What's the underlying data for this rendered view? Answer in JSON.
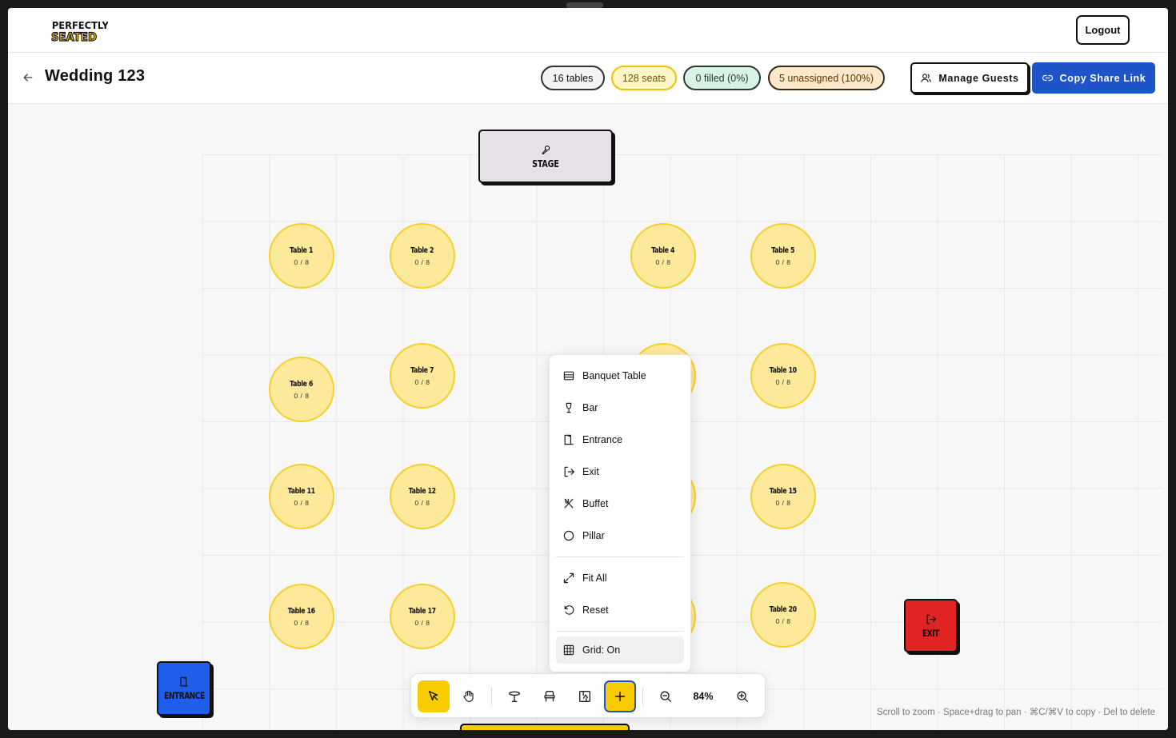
{
  "header": {
    "logo_text": "PERFECTLY SEATED",
    "logout_label": "Logout"
  },
  "subbar": {
    "title": "Wedding 123",
    "stats": {
      "tables": "16 tables",
      "seats": "128 seats",
      "filled": "0 filled (0%)",
      "unassigned": "5 unassigned (100%)"
    },
    "manage_guests_label": "Manage Guests",
    "copy_share_label": "Copy Share Link"
  },
  "canvas": {
    "stage_label": "STAGE",
    "entrance_label": "ENTRANCE",
    "exit_label": "EXIT",
    "tables": [
      {
        "name": "Table 1",
        "count": "0 / 8"
      },
      {
        "name": "Table 2",
        "count": "0 / 8"
      },
      {
        "name": "Table 4",
        "count": "0 / 8"
      },
      {
        "name": "Table 5",
        "count": "0 / 8"
      },
      {
        "name": "Table 6",
        "count": "0 / 8"
      },
      {
        "name": "Table 7",
        "count": "0 / 8"
      },
      {
        "name": "Table 10",
        "count": "0 / 8"
      },
      {
        "name": "Table 11",
        "count": "0 / 8"
      },
      {
        "name": "Table 12",
        "count": "0 / 8"
      },
      {
        "name": "Table 15",
        "count": "0 / 8"
      },
      {
        "name": "Table 16",
        "count": "0 / 8"
      },
      {
        "name": "Table 17",
        "count": "0 / 8"
      },
      {
        "name": "Table 20",
        "count": "0 / 8"
      }
    ]
  },
  "menu": {
    "items": [
      {
        "label": "Banquet Table",
        "icon": "banquet-table-icon"
      },
      {
        "label": "Bar",
        "icon": "bar-icon"
      },
      {
        "label": "Entrance",
        "icon": "entrance-icon"
      },
      {
        "label": "Exit",
        "icon": "exit-icon"
      },
      {
        "label": "Buffet",
        "icon": "buffet-icon"
      },
      {
        "label": "Pillar",
        "icon": "pillar-icon"
      }
    ],
    "fit_all_label": "Fit All",
    "reset_label": "Reset",
    "grid_label": "Grid: On"
  },
  "toolbar": {
    "zoom": "84%"
  },
  "hint": "Scroll to zoom · Space+drag to pan · ⌘C/⌘V to copy · Del to delete",
  "colors": {
    "table_fill": "#fde99a",
    "table_border": "#f5cf2e",
    "accent_blue": "#1e54c8",
    "accent_yellow": "#f8cc00",
    "exit_red": "#e02424",
    "entrance_blue": "#1f5ee8"
  }
}
